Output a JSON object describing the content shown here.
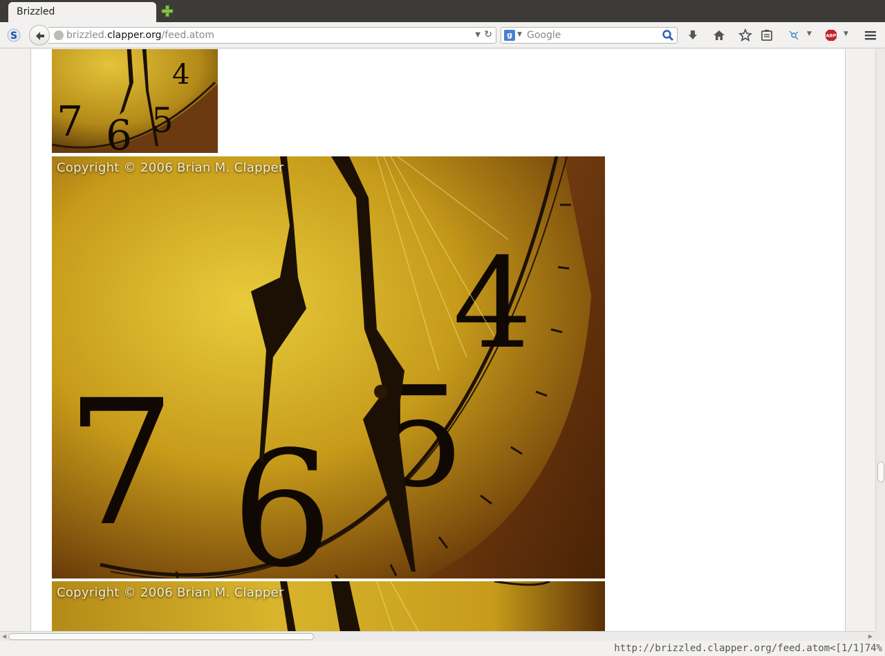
{
  "tab": {
    "title": "Brizzled"
  },
  "navbar": {
    "url_host_prefix": "brizzled.",
    "url_domain": "clapper.org",
    "url_path": "/feed.atom",
    "search_engine_icon": "g",
    "search_placeholder": "Google"
  },
  "toolbar": {
    "icons": [
      "download-icon",
      "home-icon",
      "bookmark-star-icon",
      "reading-list-icon",
      "network-icon",
      "adblock-icon",
      "menu-icon"
    ],
    "adblock_label": "ABP"
  },
  "content": {
    "caption_large": "Copyright © 2006 Brian M. Clapper",
    "caption_third": "Copyright © 2006 Brian M. Clapper",
    "clock_numerals": [
      "7",
      "6",
      "5",
      "4"
    ]
  },
  "statusbar": {
    "text": "http://brizzled.clapper.org/feed.atom<[1/1]74%"
  },
  "colors": {
    "tabbar": "#3c3b37",
    "clock_face": "#c9a21e",
    "clock_dark": "#3d2306"
  }
}
